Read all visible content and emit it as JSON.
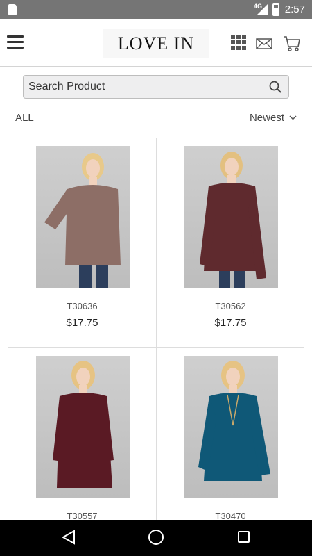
{
  "status_bar": {
    "network": "4G",
    "time": "2:57"
  },
  "header": {
    "logo": "LOVE IN"
  },
  "search": {
    "placeholder": "Search Product"
  },
  "filter": {
    "category": "ALL",
    "sort": "Newest"
  },
  "products": [
    {
      "sku": "T30636",
      "price": "$17.75",
      "color": "#8d6e66",
      "icon": "model-photo"
    },
    {
      "sku": "T30562",
      "price": "$17.75",
      "color": "#5f2a2e",
      "icon": "model-photo"
    },
    {
      "sku": "T30557",
      "price": "",
      "color": "#5a1a24",
      "icon": "model-photo"
    },
    {
      "sku": "T30470",
      "price": "",
      "color": "#0f5877",
      "icon": "model-photo"
    }
  ]
}
